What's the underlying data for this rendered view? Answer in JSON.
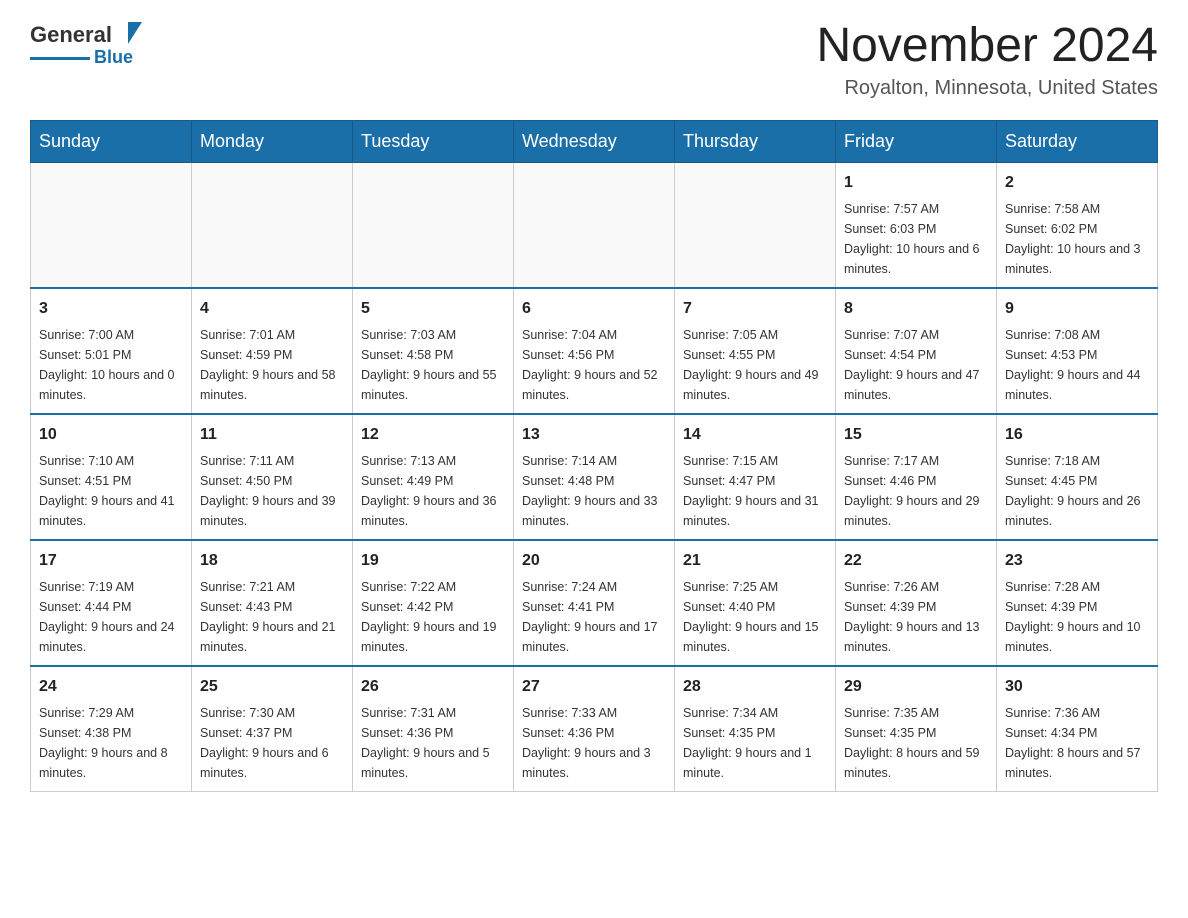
{
  "header": {
    "logo_general": "General",
    "logo_blue": "Blue",
    "main_title": "November 2024",
    "subtitle": "Royalton, Minnesota, United States"
  },
  "calendar": {
    "days_of_week": [
      "Sunday",
      "Monday",
      "Tuesday",
      "Wednesday",
      "Thursday",
      "Friday",
      "Saturday"
    ],
    "weeks": [
      [
        {
          "day": "",
          "info": ""
        },
        {
          "day": "",
          "info": ""
        },
        {
          "day": "",
          "info": ""
        },
        {
          "day": "",
          "info": ""
        },
        {
          "day": "",
          "info": ""
        },
        {
          "day": "1",
          "info": "Sunrise: 7:57 AM\nSunset: 6:03 PM\nDaylight: 10 hours and 6 minutes."
        },
        {
          "day": "2",
          "info": "Sunrise: 7:58 AM\nSunset: 6:02 PM\nDaylight: 10 hours and 3 minutes."
        }
      ],
      [
        {
          "day": "3",
          "info": "Sunrise: 7:00 AM\nSunset: 5:01 PM\nDaylight: 10 hours and 0 minutes."
        },
        {
          "day": "4",
          "info": "Sunrise: 7:01 AM\nSunset: 4:59 PM\nDaylight: 9 hours and 58 minutes."
        },
        {
          "day": "5",
          "info": "Sunrise: 7:03 AM\nSunset: 4:58 PM\nDaylight: 9 hours and 55 minutes."
        },
        {
          "day": "6",
          "info": "Sunrise: 7:04 AM\nSunset: 4:56 PM\nDaylight: 9 hours and 52 minutes."
        },
        {
          "day": "7",
          "info": "Sunrise: 7:05 AM\nSunset: 4:55 PM\nDaylight: 9 hours and 49 minutes."
        },
        {
          "day": "8",
          "info": "Sunrise: 7:07 AM\nSunset: 4:54 PM\nDaylight: 9 hours and 47 minutes."
        },
        {
          "day": "9",
          "info": "Sunrise: 7:08 AM\nSunset: 4:53 PM\nDaylight: 9 hours and 44 minutes."
        }
      ],
      [
        {
          "day": "10",
          "info": "Sunrise: 7:10 AM\nSunset: 4:51 PM\nDaylight: 9 hours and 41 minutes."
        },
        {
          "day": "11",
          "info": "Sunrise: 7:11 AM\nSunset: 4:50 PM\nDaylight: 9 hours and 39 minutes."
        },
        {
          "day": "12",
          "info": "Sunrise: 7:13 AM\nSunset: 4:49 PM\nDaylight: 9 hours and 36 minutes."
        },
        {
          "day": "13",
          "info": "Sunrise: 7:14 AM\nSunset: 4:48 PM\nDaylight: 9 hours and 33 minutes."
        },
        {
          "day": "14",
          "info": "Sunrise: 7:15 AM\nSunset: 4:47 PM\nDaylight: 9 hours and 31 minutes."
        },
        {
          "day": "15",
          "info": "Sunrise: 7:17 AM\nSunset: 4:46 PM\nDaylight: 9 hours and 29 minutes."
        },
        {
          "day": "16",
          "info": "Sunrise: 7:18 AM\nSunset: 4:45 PM\nDaylight: 9 hours and 26 minutes."
        }
      ],
      [
        {
          "day": "17",
          "info": "Sunrise: 7:19 AM\nSunset: 4:44 PM\nDaylight: 9 hours and 24 minutes."
        },
        {
          "day": "18",
          "info": "Sunrise: 7:21 AM\nSunset: 4:43 PM\nDaylight: 9 hours and 21 minutes."
        },
        {
          "day": "19",
          "info": "Sunrise: 7:22 AM\nSunset: 4:42 PM\nDaylight: 9 hours and 19 minutes."
        },
        {
          "day": "20",
          "info": "Sunrise: 7:24 AM\nSunset: 4:41 PM\nDaylight: 9 hours and 17 minutes."
        },
        {
          "day": "21",
          "info": "Sunrise: 7:25 AM\nSunset: 4:40 PM\nDaylight: 9 hours and 15 minutes."
        },
        {
          "day": "22",
          "info": "Sunrise: 7:26 AM\nSunset: 4:39 PM\nDaylight: 9 hours and 13 minutes."
        },
        {
          "day": "23",
          "info": "Sunrise: 7:28 AM\nSunset: 4:39 PM\nDaylight: 9 hours and 10 minutes."
        }
      ],
      [
        {
          "day": "24",
          "info": "Sunrise: 7:29 AM\nSunset: 4:38 PM\nDaylight: 9 hours and 8 minutes."
        },
        {
          "day": "25",
          "info": "Sunrise: 7:30 AM\nSunset: 4:37 PM\nDaylight: 9 hours and 6 minutes."
        },
        {
          "day": "26",
          "info": "Sunrise: 7:31 AM\nSunset: 4:36 PM\nDaylight: 9 hours and 5 minutes."
        },
        {
          "day": "27",
          "info": "Sunrise: 7:33 AM\nSunset: 4:36 PM\nDaylight: 9 hours and 3 minutes."
        },
        {
          "day": "28",
          "info": "Sunrise: 7:34 AM\nSunset: 4:35 PM\nDaylight: 9 hours and 1 minute."
        },
        {
          "day": "29",
          "info": "Sunrise: 7:35 AM\nSunset: 4:35 PM\nDaylight: 8 hours and 59 minutes."
        },
        {
          "day": "30",
          "info": "Sunrise: 7:36 AM\nSunset: 4:34 PM\nDaylight: 8 hours and 57 minutes."
        }
      ]
    ]
  }
}
